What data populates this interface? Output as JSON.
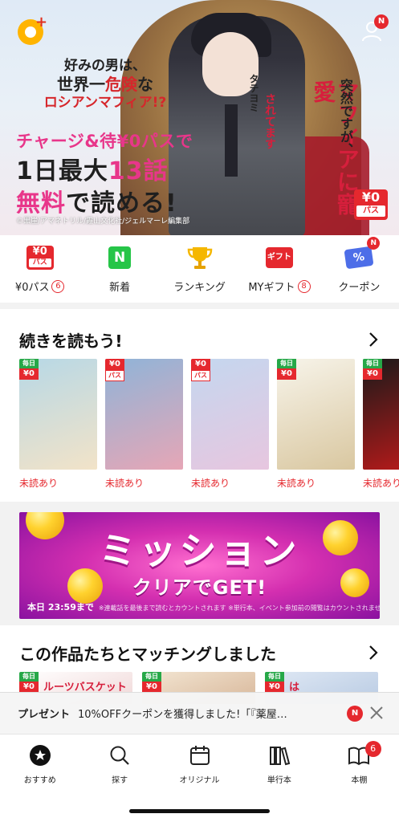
{
  "hero": {
    "catch_line1": "好みの男は、",
    "catch_line2_a": "世界一",
    "catch_line2_b": "危険",
    "catch_line2_c": "な",
    "catch_line3": "ロシアンマフィア!?",
    "campaign_line1": "チャージ&待¥0パスで",
    "campaign_line2_a": "1日最大",
    "campaign_line2_b": "13話",
    "campaign_line3_a": "無料",
    "campaign_line3_b": "で読める!",
    "copyright": "©黒崖/アマネトリル/霞山文化社/ジェルマーレ編集部",
    "title_vertical": "マフィアに寵愛",
    "title_small": "突然ですが、",
    "title_side": "されてます",
    "title_ruby": "タテヨミ",
    "zero_badge_top": "¥0",
    "zero_badge_bottom": "パス",
    "user_badge": "N"
  },
  "quick_menu": [
    {
      "label": "¥0パス",
      "badge": "6",
      "icon": "zero-pass-icon",
      "icon_top": "¥0",
      "icon_bottom": "パス"
    },
    {
      "label": "新着",
      "badge": "",
      "icon": "new-icon",
      "icon_text": "N"
    },
    {
      "label": "ランキング",
      "badge": "",
      "icon": "trophy-icon"
    },
    {
      "label": "MYギフト",
      "badge": "8",
      "icon": "gift-icon",
      "icon_text": "ギフト"
    },
    {
      "label": "クーポン",
      "badge": "",
      "icon": "coupon-icon",
      "icon_text": "%",
      "dot": "N"
    }
  ],
  "continue_section": {
    "title": "続きを読もう!",
    "books": [
      {
        "tag_top": "毎日",
        "tag_bottom": "¥0",
        "tag_type": "daily",
        "status": "未読あり",
        "color1": "#b7d8e6",
        "color2": "#f2e3c8"
      },
      {
        "tag_top": "¥0",
        "tag_bottom": "パス",
        "tag_type": "zero",
        "status": "未読あり",
        "color1": "#8fb4d8",
        "color2": "#e6a6b6"
      },
      {
        "tag_top": "¥0",
        "tag_bottom": "パス",
        "tag_type": "zero",
        "status": "未読あり",
        "color1": "#c4d7ef",
        "color2": "#e7c6df"
      },
      {
        "tag_top": "毎日",
        "tag_bottom": "¥0",
        "tag_type": "daily",
        "status": "未読あり",
        "color1": "#f7f4ea",
        "color2": "#d9c7a0"
      },
      {
        "tag_top": "毎日",
        "tag_bottom": "¥0",
        "tag_type": "daily",
        "status": "未読あり",
        "color1": "#1a1a1a",
        "color2": "#c21a1a"
      }
    ]
  },
  "mission_banner": {
    "title": "ミッション",
    "subtitle": "クリアでGET!",
    "deadline": "本日 23:59まで",
    "note": "※連載話を最後まで読むとカウントされます ※単行本、イベント参加前の閲覧はカウントされません"
  },
  "matching_section": {
    "title": "この作品たちとマッチングしました",
    "books": [
      {
        "tag_top": "毎日",
        "tag_bottom": "¥0",
        "cover_text": "ルーツバスケット",
        "color1": "#ffffff",
        "color2": "#f0d7d7"
      },
      {
        "tag_top": "毎日",
        "tag_bottom": "¥0",
        "cover_text": "",
        "color1": "#f3e6d3",
        "color2": "#d8b79a"
      },
      {
        "tag_top": "毎日",
        "tag_bottom": "¥0",
        "cover_text": "は",
        "color1": "#dfe8f4",
        "color2": "#b9cbe3"
      }
    ]
  },
  "notice": {
    "label": "プレゼント",
    "message": "10%OFFクーポンを獲得しました!「『薬屋…",
    "badge": "N"
  },
  "tabbar": [
    {
      "label": "おすすめ",
      "icon": "recommend-icon",
      "badge": ""
    },
    {
      "label": "探す",
      "icon": "search-icon",
      "badge": ""
    },
    {
      "label": "オリジナル",
      "icon": "calendar-icon",
      "badge": ""
    },
    {
      "label": "単行本",
      "icon": "books-icon",
      "badge": ""
    },
    {
      "label": "本棚",
      "icon": "bookshelf-icon",
      "badge": "6"
    }
  ],
  "colors": {
    "accent": "#e5282e",
    "green": "#26c548",
    "pink": "#e8368a"
  }
}
